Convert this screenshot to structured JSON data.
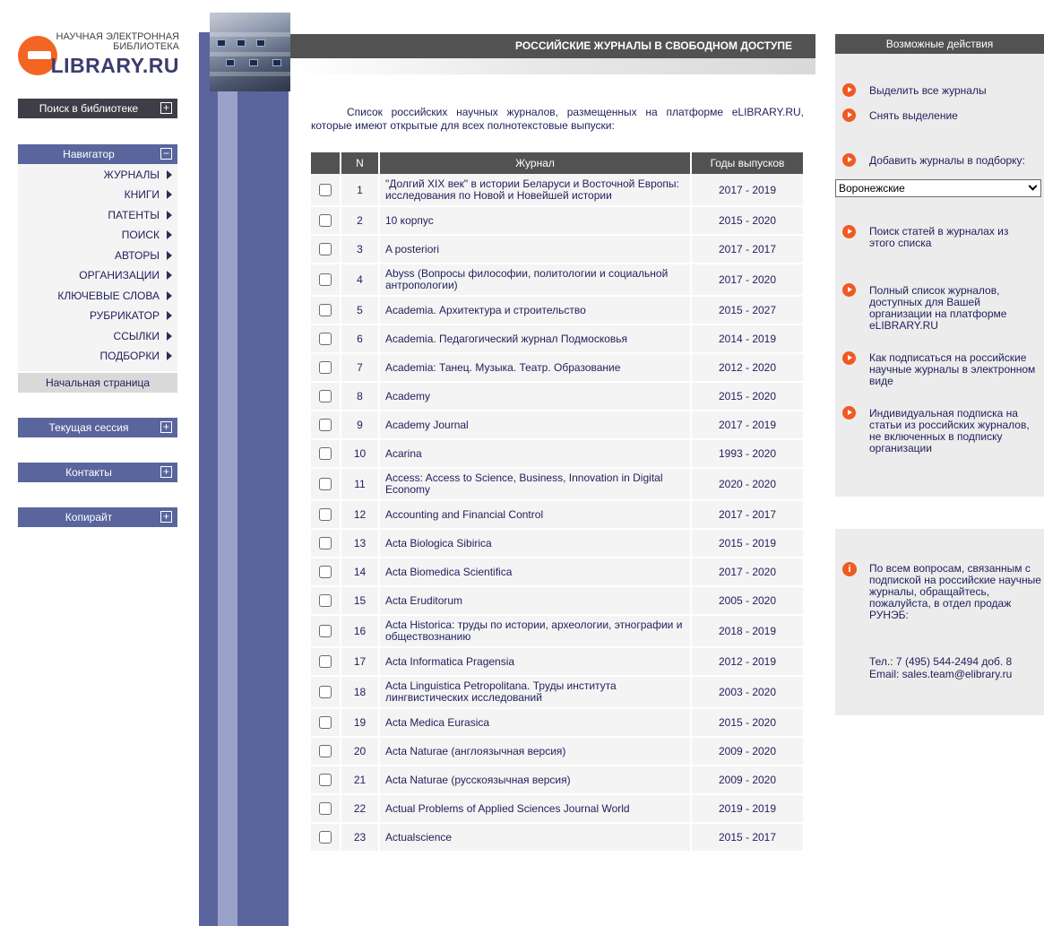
{
  "logo": {
    "line1": "НАУЧНАЯ ЭЛЕКТРОННАЯ",
    "line2": "БИБЛИОТЕКА",
    "brand": "LIBRARY.RU"
  },
  "sidebar": {
    "search_library": "Поиск в библиотеке",
    "navigator": "Навигатор",
    "nav_items": [
      "ЖУРНАЛЫ",
      "КНИГИ",
      "ПАТЕНТЫ",
      "ПОИСК",
      "АВТОРЫ",
      "ОРГАНИЗАЦИИ",
      "КЛЮЧЕВЫЕ СЛОВА",
      "РУБРИКАТОР",
      "ССЫЛКИ",
      "ПОДБОРКИ"
    ],
    "home": "Начальная страница",
    "current_session": "Текущая сессия",
    "contacts": "Контакты",
    "copyright": "Копирайт"
  },
  "main": {
    "title": "РОССИЙСКИЕ ЖУРНАЛЫ В СВОБОДНОМ ДОСТУПЕ",
    "intro": "Список российских научных журналов, размещенных на платформе eLIBRARY.RU, которые имеют открытые для всех полнотекстовые выпуски:",
    "columns": {
      "num": "N",
      "journal": "Журнал",
      "years": "Годы выпусков"
    },
    "journals": [
      {
        "n": "1",
        "title": "\"Долгий XIX век\" в истории Беларуси и Восточной Европы: исследования по Новой и Новейшей истории",
        "years": "2017 - 2019"
      },
      {
        "n": "2",
        "title": "10 корпус",
        "years": "2015 - 2020"
      },
      {
        "n": "3",
        "title": "A posteriori",
        "years": "2017 - 2017"
      },
      {
        "n": "4",
        "title": "Abyss (Вопросы философии, политологии и социальной антропологии)",
        "years": "2017 - 2020"
      },
      {
        "n": "5",
        "title": "Academia. Архитектура и строительство",
        "years": "2015 - 2027"
      },
      {
        "n": "6",
        "title": "Academia. Педагогический журнал Подмосковья",
        "years": "2014 - 2019"
      },
      {
        "n": "7",
        "title": "Academia: Танец. Музыка. Театр. Образование",
        "years": "2012 - 2020"
      },
      {
        "n": "8",
        "title": "Academy",
        "years": "2015 - 2020"
      },
      {
        "n": "9",
        "title": "Academy Journal",
        "years": "2017 - 2019"
      },
      {
        "n": "10",
        "title": "Acarina",
        "years": "1993 - 2020"
      },
      {
        "n": "11",
        "title": "Access: Access to Science, Business, Innovation in Digital Economy",
        "years": "2020 - 2020"
      },
      {
        "n": "12",
        "title": "Accounting and Financial Control",
        "years": "2017 - 2017"
      },
      {
        "n": "13",
        "title": "Acta Biologica Sibirica",
        "years": "2015 - 2019"
      },
      {
        "n": "14",
        "title": "Acta Biomedica Scientifica",
        "years": "2017 - 2020"
      },
      {
        "n": "15",
        "title": "Acta Eruditorum",
        "years": "2005 - 2020"
      },
      {
        "n": "16",
        "title": "Acta Historica: труды по истории, археологии, этнографии и обществознанию",
        "years": "2018 - 2019"
      },
      {
        "n": "17",
        "title": "Acta Informatica Pragensia",
        "years": "2012 - 2019"
      },
      {
        "n": "18",
        "title": "Acta Linguistica Petropolitana. Труды института лингвистических исследований",
        "years": "2003 - 2020"
      },
      {
        "n": "19",
        "title": "Acta Medica Eurasica",
        "years": "2015 - 2020"
      },
      {
        "n": "20",
        "title": "Acta Naturae (англоязычная версия)",
        "years": "2009 - 2020"
      },
      {
        "n": "21",
        "title": "Acta Naturae (русскоязычная версия)",
        "years": "2009 - 2020"
      },
      {
        "n": "22",
        "title": "Actual Problems of Applied Sciences Journal World",
        "years": "2019 - 2019"
      },
      {
        "n": "23",
        "title": "Actualscience",
        "years": "2015 - 2017"
      }
    ]
  },
  "actions": {
    "header": "Возможные действия",
    "select_all": "Выделить все журналы",
    "deselect": "Снять выделение",
    "add_to_collection": "Добавить журналы в подборку:",
    "collection_value": "Воронежские",
    "search_articles": "Поиск статей в журналах из этого списка",
    "full_list": "Полный список журналов, доступных для Вашей организации на платформе eLIBRARY.RU",
    "how_subscribe": "Как подписаться на российские научные журналы в электронном виде",
    "individual": "Индивидуальная подписка на статьи из российских журналов, не включенных в подписку организации"
  },
  "info": {
    "text": "По всем вопросам, связанным с подпиской на российские научные журналы, обращайтесь, пожалуйста, в отдел продаж РУНЭБ:",
    "phone": "Тел.: 7 (495) 544-2494 доб. 8",
    "email": "Email: sales.team@elibrary.ru"
  },
  "colors": {
    "accent": "#ef5a23",
    "nav": "#5a659d",
    "header": "#525252"
  }
}
